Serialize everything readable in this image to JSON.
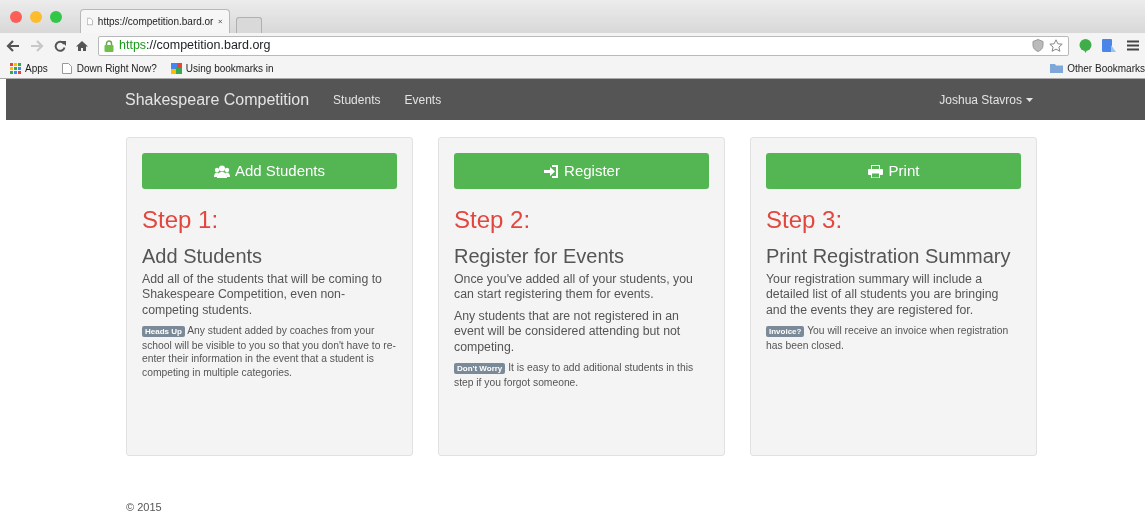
{
  "browser": {
    "tab_title": "https://competition.bard.or",
    "url_scheme": "https",
    "url_rest": "://competition.bard.org",
    "bookmarks": [
      {
        "label": "Apps",
        "kind": "apps"
      },
      {
        "label": "Down Right Now?",
        "kind": "page"
      },
      {
        "label": "Using bookmarks in",
        "kind": "google"
      }
    ],
    "other_bookmarks": "Other Bookmarks"
  },
  "navbar": {
    "brand": "Shakespeare Competition",
    "links": [
      "Students",
      "Events"
    ],
    "user": "Joshua Stavros"
  },
  "cards": [
    {
      "button": {
        "label": "Add Students"
      },
      "step": "Step 1:",
      "heading": "Add Students",
      "paragraphs": [
        "Add all of the students that will be coming to Shakespeare Competition, even non-competing students."
      ],
      "note": {
        "badge": "Heads Up",
        "text": "Any student added by coaches from your school will be visible to you so that you don't have to re-enter their information in the event that a student is competing in multiple categories."
      }
    },
    {
      "button": {
        "label": "Register"
      },
      "step": "Step 2:",
      "heading": "Register for Events",
      "paragraphs": [
        "Once you've added all of your students, you can start registering them for events.",
        "Any students that are not registered in an event will be considered attending but not competing."
      ],
      "note": {
        "badge": "Don't Worry",
        "text": "It is easy to add aditional students in this step if you forgot someone."
      }
    },
    {
      "button": {
        "label": "Print"
      },
      "step": "Step 3:",
      "heading": "Print Registration Summary",
      "paragraphs": [
        "Your registration summary will include a detailed list of all students you are bringing and the events they are registered for."
      ],
      "note": {
        "badge": "Invoice?",
        "text": "You will receive an invoice when registration has been closed."
      }
    }
  ],
  "footer": "© 2015"
}
